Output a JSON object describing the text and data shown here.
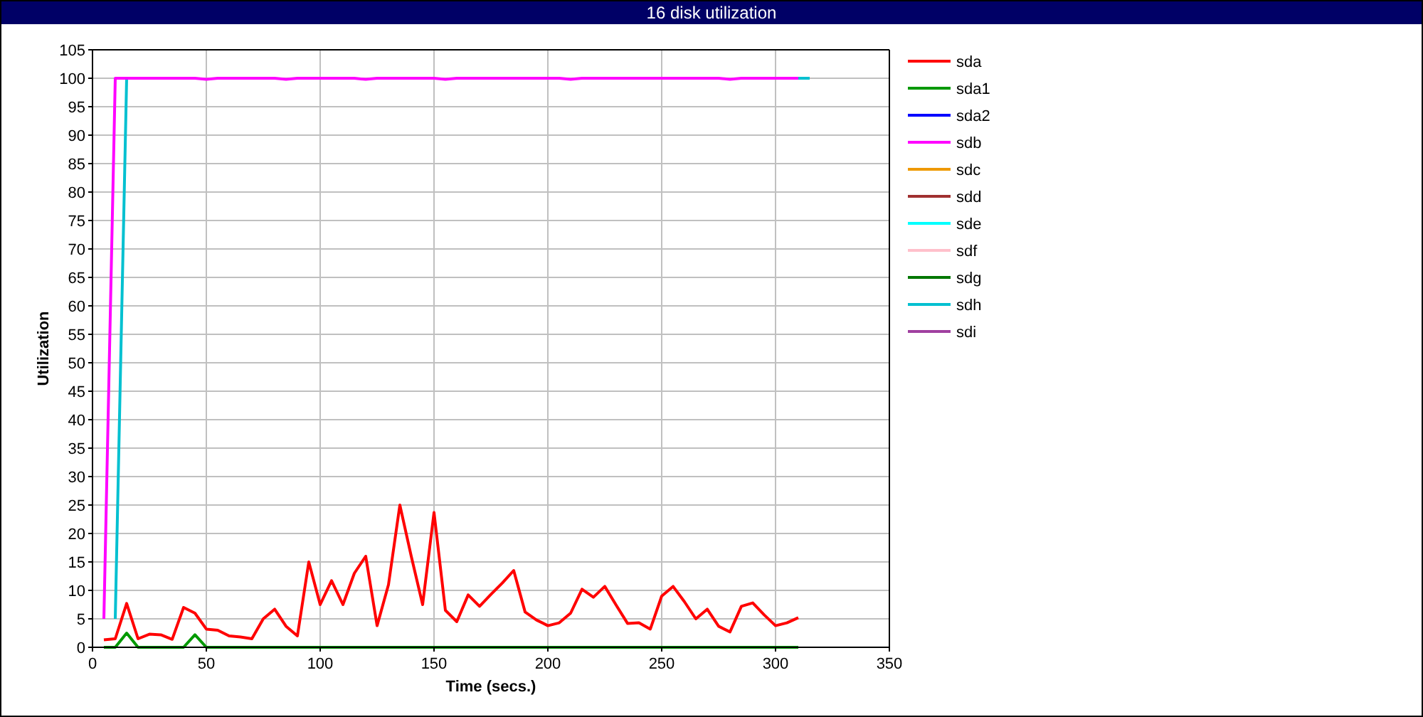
{
  "window": {
    "title": "16 disk utilization"
  },
  "chart": {
    "chart_data": {
      "type": "line",
      "xlabel": "Time (secs.)",
      "ylabel": "Utilization",
      "xlim": [
        0,
        350
      ],
      "ylim": [
        0,
        105
      ],
      "grid": true,
      "legend": true,
      "xticks": [
        0,
        50,
        100,
        150,
        200,
        250,
        300,
        350
      ],
      "yticks": [
        0,
        5,
        10,
        15,
        20,
        25,
        30,
        35,
        40,
        45,
        50,
        55,
        60,
        65,
        70,
        75,
        80,
        85,
        90,
        95,
        100,
        105
      ],
      "x": [
        5,
        10,
        15,
        20,
        25,
        30,
        35,
        40,
        45,
        50,
        55,
        60,
        65,
        70,
        75,
        80,
        85,
        90,
        95,
        100,
        105,
        110,
        115,
        120,
        125,
        130,
        135,
        140,
        145,
        150,
        155,
        160,
        165,
        170,
        175,
        180,
        185,
        190,
        195,
        200,
        205,
        210,
        215,
        220,
        225,
        230,
        235,
        240,
        245,
        250,
        255,
        260,
        265,
        270,
        275,
        280,
        285,
        290,
        295,
        300,
        305,
        310,
        315
      ],
      "series": [
        {
          "name": "sda",
          "color": "#ff0000",
          "values": [
            1.3,
            1.5,
            7.7,
            1.5,
            2.3,
            2.2,
            1.4,
            7,
            6,
            3.2,
            3,
            2,
            1.8,
            1.5,
            5,
            6.7,
            3.7,
            2,
            15,
            7.5,
            11.7,
            7.5,
            13,
            16,
            3.8,
            11,
            25,
            16,
            7.5,
            23.7,
            6.5,
            4.5,
            9.2,
            7.2,
            9.3,
            11.3,
            13.5,
            6.2,
            4.8,
            3.8,
            4.3,
            6,
            10.2,
            8.8,
            10.7,
            7.4,
            4.2,
            4.3,
            3.2,
            9,
            10.7,
            8,
            5,
            6.7,
            3.7,
            2.7,
            7.2,
            7.8,
            5.7,
            3.8,
            4.3,
            5.2,
            null
          ]
        },
        {
          "name": "sda1",
          "color": "#009900",
          "values": [
            0,
            0,
            2.5,
            0,
            0,
            0,
            0,
            0,
            2.2,
            0,
            0,
            0,
            0,
            0,
            0,
            0,
            0,
            0,
            0,
            0,
            0,
            0,
            0,
            0,
            0,
            0,
            0,
            0,
            0,
            0,
            0,
            0,
            0,
            0,
            0,
            0,
            0,
            0,
            0,
            0,
            0,
            0,
            0,
            0,
            0,
            0,
            0,
            0,
            0,
            0,
            0,
            0,
            0,
            0,
            0,
            0,
            0,
            0,
            0,
            0,
            0,
            0,
            null
          ]
        },
        {
          "name": "sda2",
          "color": "#0000ff",
          "values": [
            null,
            null,
            null,
            null,
            null,
            null,
            null,
            null,
            null,
            null,
            null,
            null,
            null,
            null,
            null,
            null,
            null,
            null,
            null,
            null,
            null,
            null,
            null,
            null,
            null,
            null,
            null,
            null,
            null,
            null,
            null,
            null,
            null,
            null,
            null,
            null,
            null,
            null,
            null,
            null,
            null,
            null,
            null,
            null,
            null,
            null,
            null,
            null,
            null,
            null,
            null,
            null,
            null,
            null,
            null,
            null,
            null,
            null,
            null,
            null,
            null,
            null,
            null
          ]
        },
        {
          "name": "sdb",
          "color": "#ff00ff",
          "values": [
            5,
            100,
            100,
            100,
            100,
            100,
            100,
            100,
            100,
            99.8,
            100,
            100,
            100,
            100,
            100,
            100,
            99.8,
            100,
            100,
            100,
            100,
            100,
            100,
            99.8,
            100,
            100,
            100,
            100,
            100,
            100,
            99.8,
            100,
            100,
            100,
            100,
            100,
            100,
            100,
            100,
            100,
            100,
            99.8,
            100,
            100,
            100,
            100,
            100,
            100,
            100,
            100,
            100,
            100,
            100,
            100,
            100,
            99.8,
            100,
            100,
            100,
            100,
            100,
            100,
            null
          ]
        },
        {
          "name": "sdc",
          "color": "#ee9900",
          "values": [
            null,
            null,
            null,
            null,
            null,
            null,
            null,
            null,
            null,
            null,
            null,
            null,
            null,
            null,
            null,
            null,
            null,
            null,
            null,
            null,
            null,
            null,
            null,
            null,
            null,
            null,
            null,
            null,
            null,
            null,
            null,
            null,
            null,
            null,
            null,
            null,
            null,
            null,
            null,
            null,
            null,
            null,
            null,
            null,
            null,
            null,
            null,
            null,
            null,
            null,
            null,
            null,
            null,
            null,
            null,
            null,
            null,
            null,
            null,
            null,
            null,
            null,
            null
          ]
        },
        {
          "name": "sdd",
          "color": "#a03030",
          "values": [
            null,
            null,
            null,
            null,
            null,
            null,
            null,
            null,
            null,
            null,
            null,
            null,
            null,
            null,
            null,
            null,
            null,
            null,
            null,
            null,
            null,
            null,
            null,
            null,
            null,
            null,
            null,
            null,
            null,
            null,
            null,
            null,
            null,
            null,
            null,
            null,
            null,
            null,
            null,
            null,
            null,
            null,
            null,
            null,
            null,
            null,
            null,
            null,
            null,
            null,
            null,
            null,
            null,
            null,
            null,
            null,
            null,
            null,
            null,
            null,
            null,
            null,
            null
          ]
        },
        {
          "name": "sde",
          "color": "#00ffff",
          "values": [
            null,
            null,
            null,
            null,
            null,
            null,
            null,
            null,
            null,
            null,
            null,
            null,
            null,
            null,
            null,
            null,
            null,
            null,
            null,
            null,
            null,
            null,
            null,
            null,
            null,
            null,
            null,
            null,
            null,
            null,
            null,
            null,
            null,
            null,
            null,
            null,
            null,
            null,
            null,
            null,
            null,
            null,
            null,
            null,
            null,
            null,
            null,
            null,
            null,
            null,
            null,
            null,
            null,
            null,
            null,
            null,
            null,
            null,
            null,
            null,
            null,
            null,
            null
          ]
        },
        {
          "name": "sdf",
          "color": "#ffc0cb",
          "values": [
            null,
            null,
            null,
            null,
            null,
            null,
            null,
            null,
            null,
            null,
            null,
            null,
            null,
            null,
            null,
            null,
            null,
            null,
            null,
            null,
            null,
            null,
            null,
            null,
            null,
            null,
            null,
            null,
            null,
            null,
            null,
            null,
            null,
            null,
            null,
            null,
            null,
            null,
            null,
            null,
            null,
            null,
            null,
            null,
            null,
            null,
            null,
            null,
            null,
            null,
            null,
            null,
            null,
            null,
            null,
            null,
            null,
            null,
            null,
            null,
            null,
            null,
            null
          ]
        },
        {
          "name": "sdg",
          "color": "#007700",
          "values": [
            null,
            null,
            null,
            null,
            null,
            null,
            null,
            null,
            null,
            null,
            null,
            null,
            null,
            null,
            null,
            null,
            null,
            null,
            null,
            null,
            null,
            null,
            null,
            null,
            null,
            null,
            null,
            null,
            null,
            null,
            null,
            null,
            null,
            null,
            null,
            null,
            null,
            null,
            null,
            null,
            null,
            null,
            null,
            null,
            null,
            null,
            null,
            null,
            null,
            null,
            null,
            null,
            null,
            null,
            null,
            null,
            null,
            null,
            null,
            null,
            null,
            null,
            null
          ]
        },
        {
          "name": "sdh",
          "color": "#00c0d0",
          "values": [
            null,
            5,
            100,
            null,
            null,
            null,
            null,
            null,
            null,
            null,
            null,
            null,
            null,
            null,
            null,
            null,
            null,
            null,
            null,
            null,
            null,
            null,
            null,
            null,
            null,
            null,
            null,
            null,
            null,
            null,
            null,
            null,
            null,
            null,
            null,
            null,
            null,
            null,
            null,
            null,
            null,
            null,
            null,
            null,
            null,
            null,
            null,
            null,
            null,
            null,
            null,
            null,
            null,
            null,
            null,
            null,
            null,
            null,
            null,
            null,
            null,
            100,
            100
          ]
        },
        {
          "name": "sdi",
          "color": "#a040a0",
          "values": [
            null,
            null,
            null,
            null,
            null,
            null,
            null,
            null,
            null,
            null,
            null,
            null,
            null,
            null,
            null,
            null,
            null,
            null,
            null,
            null,
            null,
            null,
            null,
            null,
            null,
            null,
            null,
            null,
            null,
            null,
            null,
            null,
            null,
            null,
            null,
            null,
            null,
            null,
            null,
            null,
            null,
            null,
            null,
            null,
            null,
            null,
            null,
            null,
            null,
            null,
            null,
            null,
            null,
            null,
            null,
            null,
            null,
            null,
            null,
            null,
            null,
            null,
            null
          ]
        }
      ]
    }
  }
}
